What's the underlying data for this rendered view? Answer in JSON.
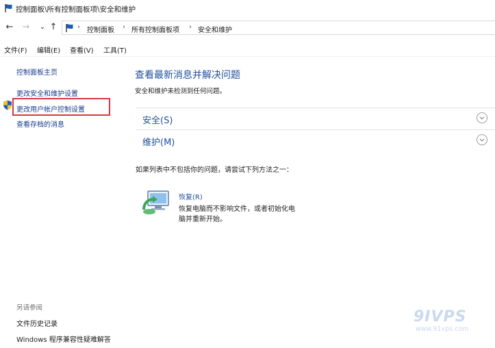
{
  "window": {
    "title": "控制面板\\所有控制面板项\\安全和维护"
  },
  "nav": {
    "back": "←",
    "forward": "→",
    "recent": "⌄",
    "up": "↑"
  },
  "address": {
    "crumbs": [
      "控制面板",
      "所有控制面板项",
      "安全和维护"
    ],
    "separator": "›"
  },
  "menubar": {
    "items": [
      "文件(F)",
      "编辑(E)",
      "查看(V)",
      "工具(T)"
    ]
  },
  "sidebar": {
    "home": "控制面板主页",
    "links": [
      "更改安全和维护设置",
      "更改用户帐户控制设置",
      "查看存档的消息"
    ],
    "see_also_title": "另请参阅",
    "see_also": [
      "文件历史记录",
      "Windows 程序兼容性疑难解答"
    ]
  },
  "main": {
    "heading": "查看最新消息并解决问题",
    "subtext": "安全和维护未检测到任何问题。",
    "sections": [
      "安全(S)",
      "维护(M)"
    ],
    "prompt": "如果列表中不包括你的问题，请尝试下列方法之一：",
    "recovery": {
      "title": "恢复(R)",
      "description": "恢复电脑而不影响文件，或者初始化电脑并重新开始。"
    }
  },
  "watermark": {
    "logo": "9IVPS",
    "url": "www.91vps.com"
  },
  "colors": {
    "link": "#1e4f9c",
    "highlight_border": "#d9363e",
    "flag_blue": "#1a5fb4"
  }
}
